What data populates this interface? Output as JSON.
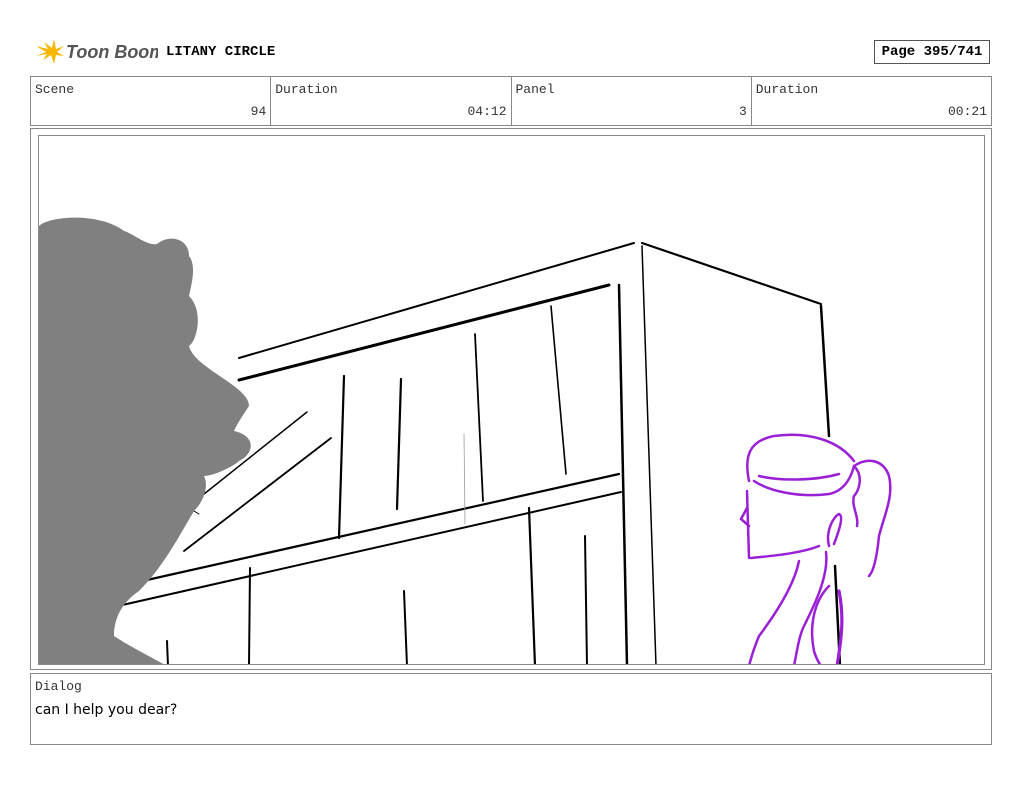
{
  "header": {
    "logo_text": "Toon Boom",
    "project_title": "LITANY CIRCLE",
    "page_label": "Page 395/741"
  },
  "info": {
    "scene_label": "Scene",
    "scene_value": "94",
    "duration_label": "Duration",
    "duration_value": "04:12",
    "panel_label": "Panel",
    "panel_value": "3",
    "panel_duration_label": "Duration",
    "panel_duration_value": "00:21"
  },
  "dialog": {
    "label": "Dialog",
    "text": "can I help you dear?"
  },
  "colors": {
    "logo_yellow": "#f5b700",
    "silhouette_gray": "#808080",
    "character_purple": "#9b1fd6"
  }
}
